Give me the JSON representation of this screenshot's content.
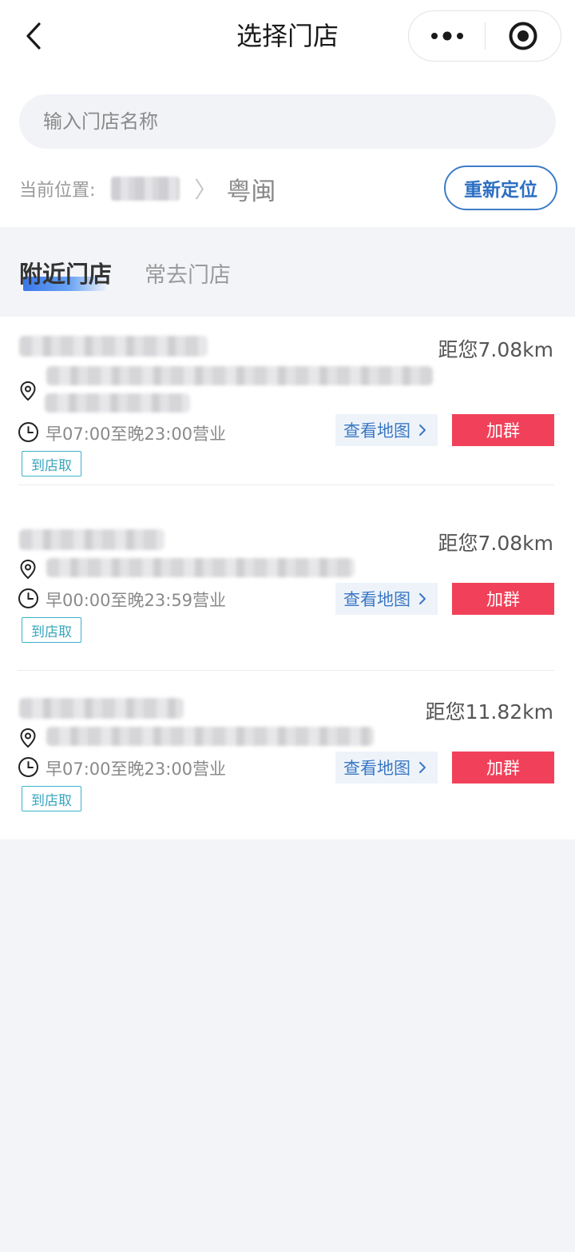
{
  "topbar": {
    "title": "选择门店",
    "back_icon": "chevron-left-icon",
    "more_icon": "more-dots-icon",
    "close_icon": "target-close-icon"
  },
  "search": {
    "placeholder": "输入门店名称",
    "value": ""
  },
  "location": {
    "label": "当前位置:",
    "area": "粤闽",
    "chevron": "〉",
    "relocate_label": "重新定位"
  },
  "tabs": [
    {
      "label": "附近门店",
      "active": true
    },
    {
      "label": "常去门店",
      "active": false
    }
  ],
  "stores": [
    {
      "distance": "距您7.08km",
      "hours": "早07:00至晚23:00营业",
      "tag": "到店取",
      "map_label": "查看地图",
      "join_label": "加群"
    },
    {
      "distance": "距您7.08km",
      "hours": "早00:00至晚23:59营业",
      "tag": "到店取",
      "map_label": "查看地图",
      "join_label": "加群"
    },
    {
      "distance": "距您11.82km",
      "hours": "早07:00至晚23:00营业",
      "tag": "到店取",
      "map_label": "查看地图",
      "join_label": "加群"
    }
  ],
  "colors": {
    "accent_blue": "#2c6fc2",
    "join_red": "#f1415a",
    "tag_teal": "#3aa6bd",
    "page_bg": "#f3f4f8"
  }
}
